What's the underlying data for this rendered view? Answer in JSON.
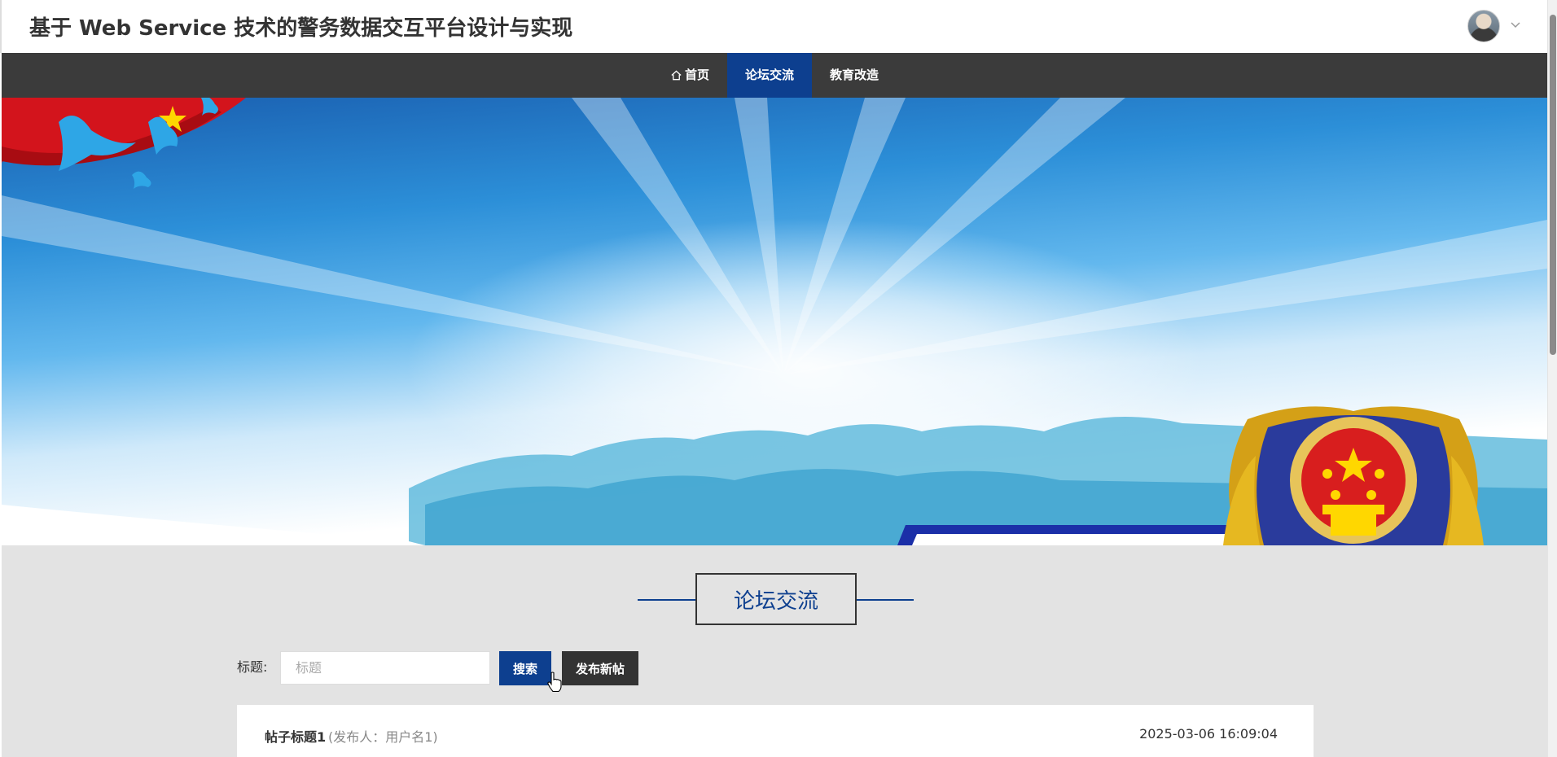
{
  "header": {
    "title": "基于 Web Service 技术的警务数据交互平台设计与实现",
    "user_menu_icon": "chevron-down-icon"
  },
  "nav": {
    "items": [
      {
        "label": "首页",
        "icon": "home-icon",
        "active": false
      },
      {
        "label": "论坛交流",
        "active": true
      },
      {
        "label": "教育改造",
        "active": false
      }
    ]
  },
  "section": {
    "title": "论坛交流"
  },
  "search": {
    "label": "标题:",
    "placeholder": "标题",
    "value": "",
    "search_button": "搜索",
    "new_post_button": "发布新帖"
  },
  "posts": [
    {
      "title": "帖子标题1",
      "author_text": "(发布人：用户名1)",
      "time": "2025-03-06 16:09:04"
    }
  ],
  "colors": {
    "accent": "#0d3f8f",
    "nav_bg": "#3b3b3b",
    "content_bg": "#e3e3e3"
  }
}
